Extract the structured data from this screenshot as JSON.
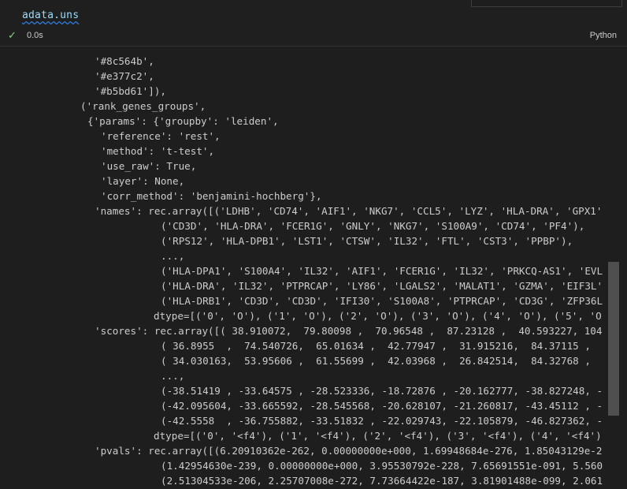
{
  "cell": {
    "code": "adata.uns",
    "duration": "0.0s",
    "language": "Python",
    "status_icon": "check-icon"
  },
  "output_lines": [
    "'#8c564b',",
    "'#e377c2',",
    "'#b5bd61']),",
    "('rank_genes_groups',",
    "{'params': {'groupby': 'leiden',",
    "'reference': 'rest',",
    "'method': 't-test',",
    "'use_raw': True,",
    "'layer': None,",
    "'corr_method': 'benjamini-hochberg'},",
    "'names': rec.array([('LDHB', 'CD74', 'AIF1', 'NKG7', 'CCL5', 'LYZ', 'HLA-DRA', 'GPX1'",
    "('CD3D', 'HLA-DRA', 'FCER1G', 'GNLY', 'NKG7', 'S100A9', 'CD74', 'PF4'),",
    "('RPS12', 'HLA-DPB1', 'LST1', 'CTSW', 'IL32', 'FTL', 'CST3', 'PPBP'),",
    "...,",
    "('HLA-DPA1', 'S100A4', 'IL32', 'AIF1', 'FCER1G', 'IL32', 'PRKCQ-AS1', 'EVL",
    "('HLA-DRA', 'IL32', 'PTPRCAP', 'LY86', 'LGALS2', 'MALAT1', 'GZMA', 'EIF3L'",
    "('HLA-DRB1', 'CD3D', 'CD3D', 'IFI30', 'S100A8', 'PTPRCAP', 'CD3G', 'ZFP36L",
    "dtype=[('0', 'O'), ('1', 'O'), ('2', 'O'), ('3', 'O'), ('4', 'O'), ('5', 'O",
    "'scores': rec.array([( 38.910072,  79.80098 ,  70.96548 ,  87.23128 ,  40.593227, 104",
    "( 36.8955  ,  74.540726,  65.01634 ,  42.77947 ,  31.915216,  84.37115 ,",
    "( 34.030163,  53.95606 ,  61.55699 ,  42.03968 ,  26.842514,  84.32768 ,",
    "...,",
    "(-38.51419 , -33.64575 , -28.523336, -18.72876 , -20.162777, -38.827248, -",
    "(-42.095604, -33.665592, -28.545568, -20.628107, -21.260817, -43.45112 , -",
    "(-42.5558  , -36.755882, -33.51832 , -22.029743, -22.105879, -46.827362, -",
    "dtype=[('0', '<f4'), ('1', '<f4'), ('2', '<f4'), ('3', '<f4'), ('4', '<f4')",
    "'pvals': rec.array([(6.20910362e-262, 0.00000000e+000, 1.69948684e-276, 1.85043129e-2",
    "(1.42954630e-239, 0.00000000e+000, 3.95530792e-228, 7.65691551e-091, 5.560",
    "(2.51304533e-206, 2.25707008e-272, 7.73664422e-187, 3.81901488e-099, 2.061"
  ]
}
